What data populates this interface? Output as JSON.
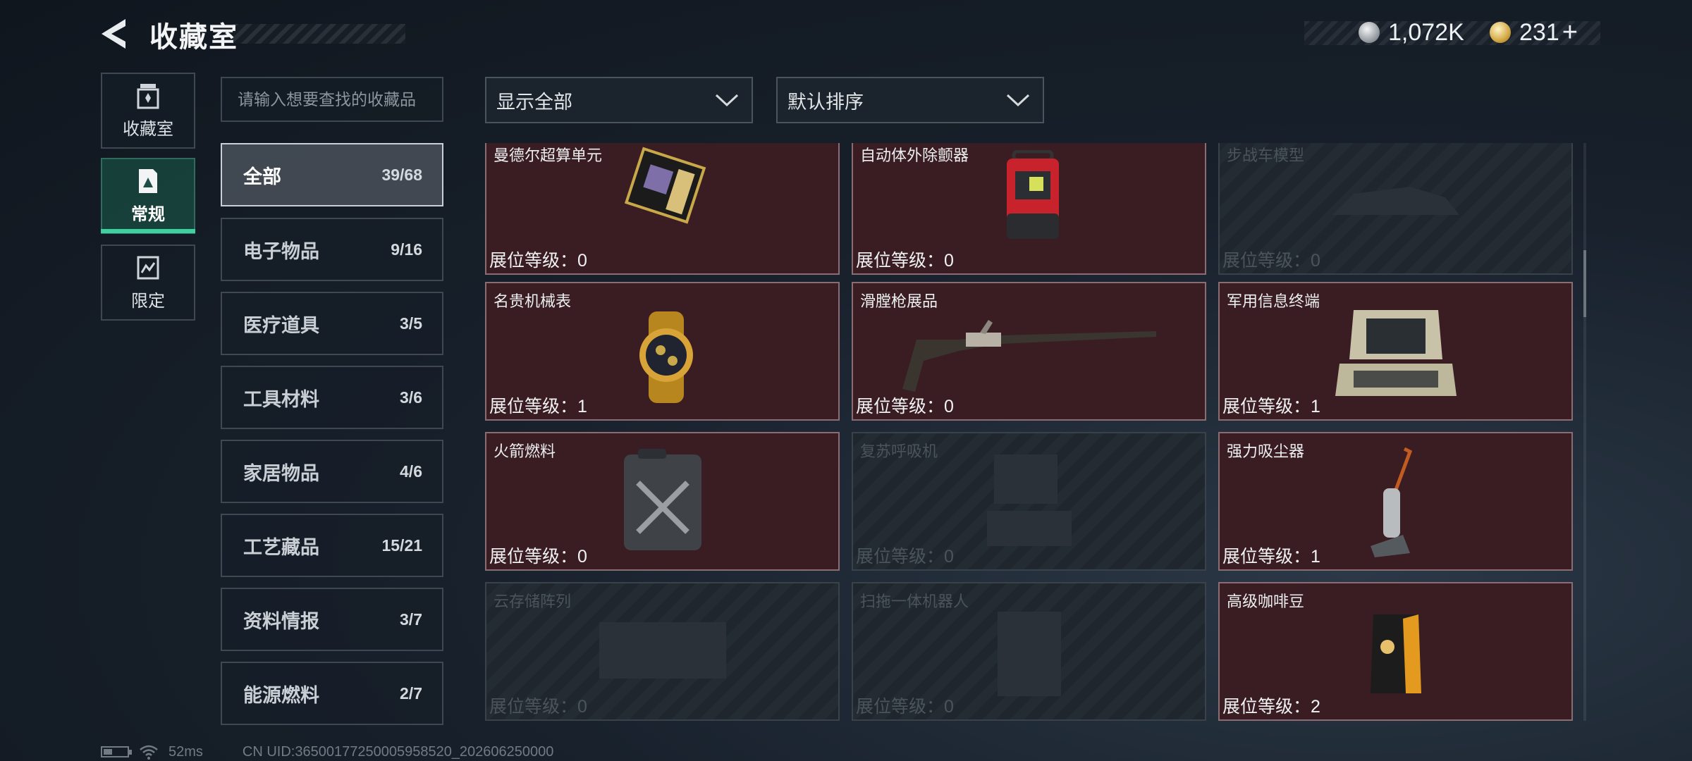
{
  "header": {
    "title": "收藏室",
    "currency": [
      {
        "icon": "silver-coin-icon",
        "value": "1,072K"
      },
      {
        "icon": "gold-coin-icon",
        "value": "231"
      }
    ],
    "add_symbol": "+"
  },
  "nav": {
    "items": [
      {
        "label": "收藏室",
        "icon": "collection-icon",
        "active": false
      },
      {
        "label": "常规",
        "icon": "regular-icon",
        "active": true
      },
      {
        "label": "限定",
        "icon": "limited-icon",
        "active": false
      }
    ]
  },
  "search": {
    "placeholder": "请输入想要查找的收藏品"
  },
  "categories": [
    {
      "name": "全部",
      "count": "39/68",
      "active": true
    },
    {
      "name": "电子物品",
      "count": "9/16"
    },
    {
      "name": "医疗道具",
      "count": "3/5"
    },
    {
      "name": "工具材料",
      "count": "3/6"
    },
    {
      "name": "家居物品",
      "count": "4/6"
    },
    {
      "name": "工艺藏品",
      "count": "15/21"
    },
    {
      "name": "资料情报",
      "count": "3/7"
    },
    {
      "name": "能源燃料",
      "count": "2/7"
    }
  ],
  "filters": {
    "display": "显示全部",
    "sort": "默认排序"
  },
  "level_label": "展位等级：",
  "items": [
    {
      "name": "曼德尔超算单元",
      "level": "0",
      "owned": true,
      "icon": "supercomputer-unit-icon"
    },
    {
      "name": "自动体外除颤器",
      "level": "0",
      "owned": true,
      "icon": "defibrillator-icon"
    },
    {
      "name": "步战车模型",
      "level": "0",
      "owned": false,
      "icon": "vehicle-model-icon"
    },
    {
      "name": "名贵机械表",
      "level": "1",
      "owned": true,
      "icon": "watch-icon"
    },
    {
      "name": "滑膛枪展品",
      "level": "0",
      "owned": true,
      "icon": "musket-icon"
    },
    {
      "name": "军用信息终端",
      "level": "1",
      "owned": true,
      "icon": "military-terminal-icon"
    },
    {
      "name": "火箭燃料",
      "level": "0",
      "owned": true,
      "icon": "fuel-can-icon"
    },
    {
      "name": "复苏呼吸机",
      "level": "0",
      "owned": false,
      "icon": "ventilator-icon"
    },
    {
      "name": "强力吸尘器",
      "level": "1",
      "owned": true,
      "icon": "vacuum-icon"
    },
    {
      "name": "云存储阵列",
      "level": "0",
      "owned": false,
      "icon": "storage-array-icon"
    },
    {
      "name": "扫拖一体机器人",
      "level": "0",
      "owned": false,
      "icon": "robot-vacuum-icon"
    },
    {
      "name": "高级咖啡豆",
      "level": "2",
      "owned": true,
      "icon": "coffee-bag-icon"
    }
  ],
  "footer": {
    "ping": "52ms",
    "uid": "CN UID:36500177250005958520_202606250000"
  },
  "colors": {
    "accent": "#3fd0a0",
    "owned_card": "#3a1d22",
    "locked_card": "#1f262d"
  }
}
